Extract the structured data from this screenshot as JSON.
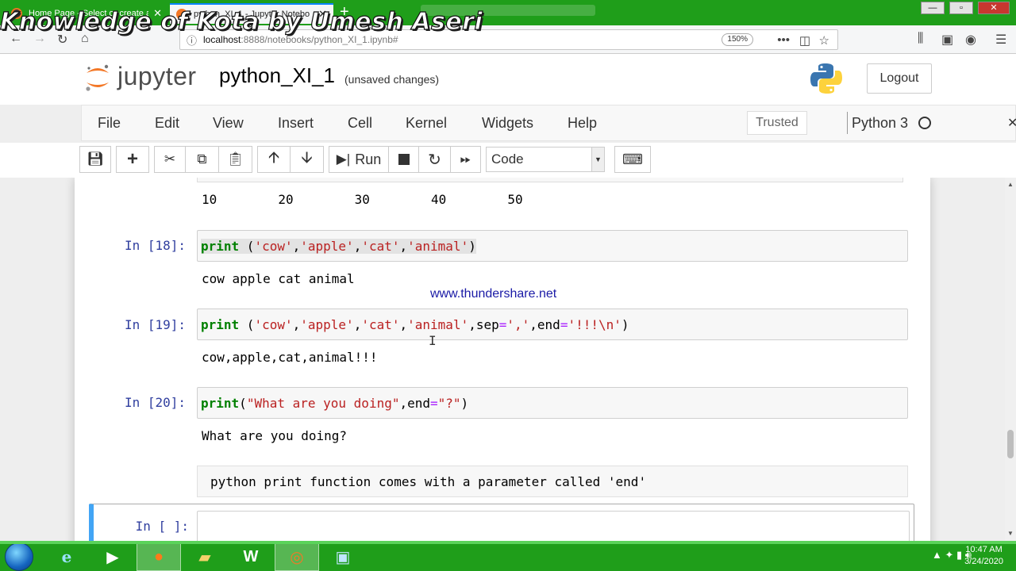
{
  "browser": {
    "tabs": [
      {
        "title": "Home Page - Select or create a"
      },
      {
        "title": "python_XI_1 - Jupyter Notebo"
      }
    ],
    "url_host": "localhost",
    "url_path": ":8888/notebooks/python_XI_1.ipynb#",
    "zoom": "150%"
  },
  "watermark": "Knowledge of Kota by Umesh Aseri",
  "jupyter": {
    "brand": "jupyter",
    "notebook_title": "python_XI_1",
    "save_status": "(unsaved changes)",
    "logout": "Logout"
  },
  "menu": {
    "items": [
      "File",
      "Edit",
      "View",
      "Insert",
      "Cell",
      "Kernel",
      "Widgets",
      "Help"
    ],
    "trusted": "Trusted",
    "kernel": "Python 3"
  },
  "toolbar": {
    "run_label": "Run",
    "cell_type": "Code"
  },
  "cells": {
    "prev_output": "10        20        30        40        50",
    "c18": {
      "prompt": "In [18]:",
      "output": "cow apple cat animal"
    },
    "c19": {
      "prompt": "In [19]:",
      "output": "cow,apple,cat,animal!!!"
    },
    "c20": {
      "prompt": "In [20]:",
      "output": "What are you doing?"
    },
    "markdown": "python print function comes with a parameter called 'end'",
    "active": {
      "prompt": "In [ ]:"
    }
  },
  "overlay_link": "www.thundershare.net",
  "taskbar": {
    "time": "10:47 AM",
    "date": "3/24/2020"
  }
}
